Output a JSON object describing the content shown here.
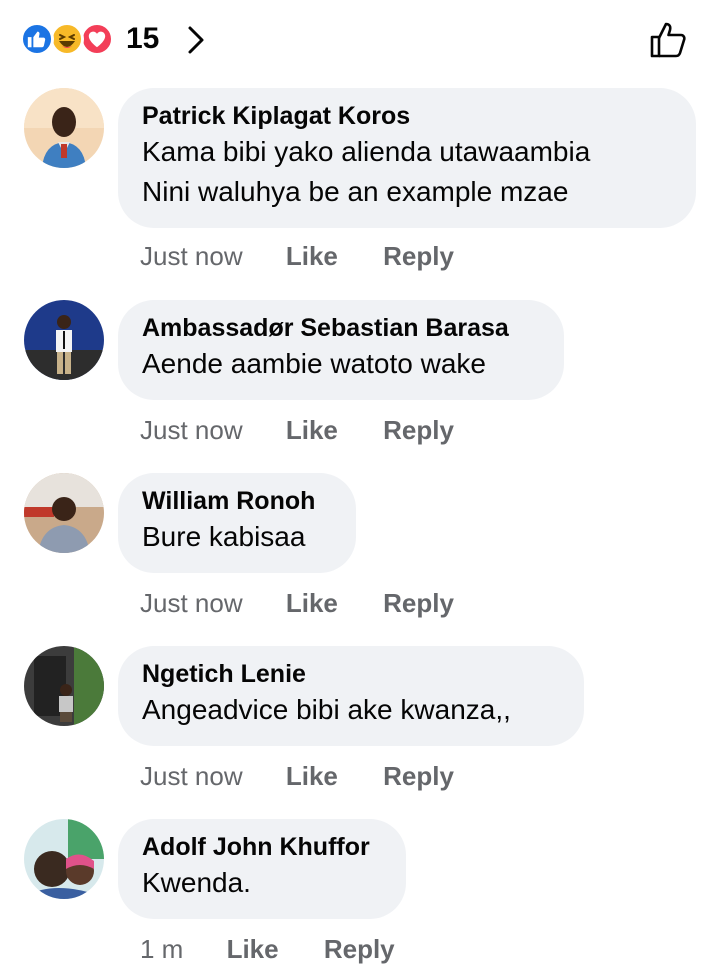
{
  "reactions": {
    "icons": [
      "like-icon",
      "haha-icon",
      "love-icon"
    ],
    "count": "15"
  },
  "comments": [
    {
      "author": "Patrick Kiplagat Koros",
      "text": "Kama bibi yako alienda utawaambia\nNini waluhya be an example mzae",
      "time": "Just now",
      "like_label": "Like",
      "reply_label": "Reply"
    },
    {
      "author": "Ambassadør Sebastian Barasa",
      "text": "Aende aambie watoto wake",
      "time": "Just now",
      "like_label": "Like",
      "reply_label": "Reply"
    },
    {
      "author": "William Ronoh",
      "text": "Bure kabisaa",
      "time": "Just now",
      "like_label": "Like",
      "reply_label": "Reply"
    },
    {
      "author": "Ngetich Lenie",
      "text": "Angeadvice bibi ake kwanza,,",
      "time": "Just now",
      "like_label": "Like",
      "reply_label": "Reply"
    },
    {
      "author": "Adolf John Khuffor",
      "text": "Kwenda.",
      "time": "1 m",
      "like_label": "Like",
      "reply_label": "Reply"
    }
  ],
  "colors": {
    "like_blue": "#1b74e4",
    "haha_yellow": "#f7b928",
    "love_red": "#f33e58",
    "bubble_bg": "#f0f2f5",
    "meta_gray": "#65676b"
  }
}
